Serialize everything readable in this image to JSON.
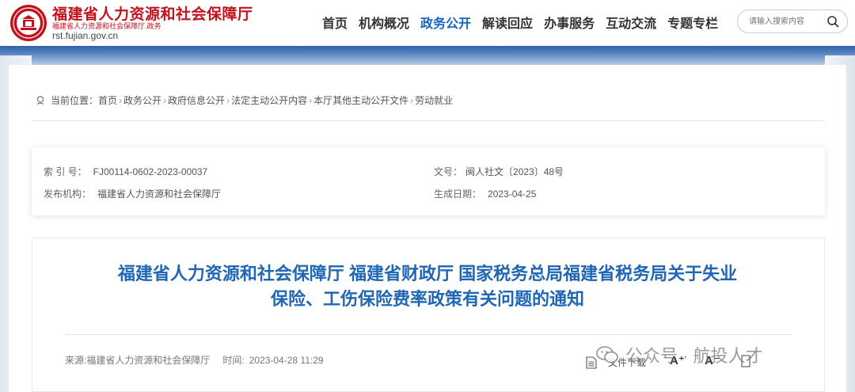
{
  "site": {
    "name": "福建省人力资源和社会保障厅",
    "sub": "福建省人力资源和社会保障厅.政务",
    "domain": "rst.fujian.gov.cn"
  },
  "nav": {
    "items": [
      {
        "label": "首页"
      },
      {
        "label": "机构概况"
      },
      {
        "label": "政务公开"
      },
      {
        "label": "解读回应"
      },
      {
        "label": "办事服务"
      },
      {
        "label": "互动交流"
      },
      {
        "label": "专题专栏"
      }
    ],
    "active_index": 2
  },
  "search": {
    "placeholder": "请输入搜索内容",
    "icon": "search-icon"
  },
  "breadcrumb": {
    "prefix": "当前位置：",
    "items": [
      "首页",
      "政务公开",
      "政府信息公开",
      "法定主动公开内容",
      "本厅其他主动公开文件",
      "劳动就业"
    ],
    "separator": "›"
  },
  "meta": {
    "index_label": "索 引 号：",
    "index_value": "FJ00114-0602-2023-00037",
    "docno_label": "文号：",
    "docno_value": "闽人社文〔2023〕48号",
    "issuer_label": "发布机构：",
    "issuer_value": "福建省人力资源和社会保障厅",
    "date_label": "生成日期：",
    "date_value": "2023-04-25"
  },
  "article": {
    "title_line1": "福建省人力资源和社会保障厅 福建省财政厅 国家税务总局福建省税务局关于失业",
    "title_line2": "保险、工伤保险费率政策有关问题的通知",
    "source": "来源:福建省人力资源和社会保障厅",
    "time_label": "时间:",
    "time_value": "2023-04-28 11:29",
    "download_label": "文件下载",
    "font_larger": "A⁺",
    "font_smaller": "A⁻"
  },
  "watermark": {
    "text": "公众号 · 航投人才"
  },
  "colors": {
    "brand_red": "#c3121c",
    "accent_blue": "#1565c0",
    "title_blue": "#1f66b5"
  }
}
